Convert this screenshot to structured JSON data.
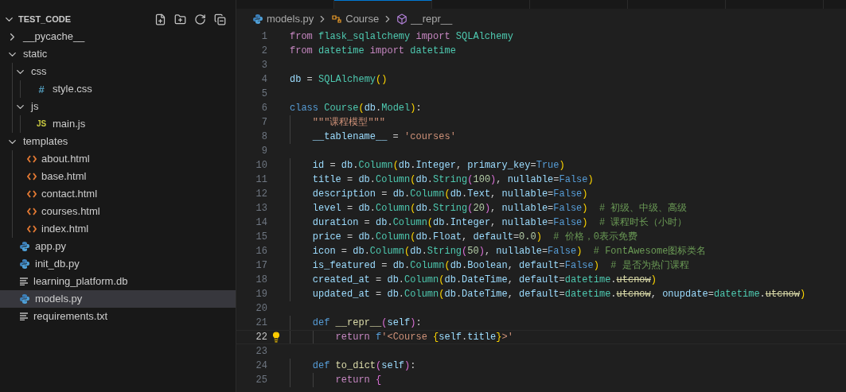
{
  "explorer": {
    "title": "TEST_CODE",
    "expanded": true,
    "items": [
      {
        "kind": "folder",
        "name": "__pycache__",
        "expanded": false,
        "selected": false
      },
      {
        "kind": "folder",
        "name": "static",
        "expanded": true,
        "selected": false,
        "children": [
          {
            "kind": "folder",
            "name": "css",
            "expanded": true,
            "selected": false,
            "children": [
              {
                "kind": "css",
                "glyph": "#",
                "name": "style.css",
                "selected": false
              }
            ]
          },
          {
            "kind": "folder",
            "name": "js",
            "expanded": true,
            "selected": false,
            "children": [
              {
                "kind": "js",
                "glyph": "JS",
                "name": "main.js",
                "selected": false
              }
            ]
          }
        ]
      },
      {
        "kind": "folder",
        "name": "templates",
        "expanded": true,
        "selected": false,
        "children": [
          {
            "kind": "html",
            "name": "about.html",
            "selected": false
          },
          {
            "kind": "html",
            "name": "base.html",
            "selected": false
          },
          {
            "kind": "html",
            "name": "contact.html",
            "selected": false
          },
          {
            "kind": "html",
            "name": "courses.html",
            "selected": false
          },
          {
            "kind": "html",
            "name": "index.html",
            "selected": false
          }
        ]
      },
      {
        "kind": "py",
        "name": "app.py",
        "selected": false
      },
      {
        "kind": "py",
        "name": "init_db.py",
        "selected": false
      },
      {
        "kind": "text",
        "name": "learning_platform.db",
        "selected": false
      },
      {
        "kind": "py",
        "name": "models.py",
        "selected": true
      },
      {
        "kind": "text",
        "name": "requirements.txt",
        "selected": false
      }
    ]
  },
  "tabs": [
    {
      "selected": false
    },
    {
      "selected": true
    },
    {
      "selected": false
    },
    {
      "selected": false
    },
    {
      "selected": false
    },
    {
      "selected": false
    }
  ],
  "breadcrumb": [
    {
      "kind": "py",
      "label": "models.py"
    },
    {
      "kind": "class",
      "label": "Course"
    },
    {
      "kind": "method",
      "label": "__repr__"
    }
  ],
  "code": [
    {
      "n": "1",
      "tokens": [
        {
          "text": "from",
          "kind": "kw"
        },
        {
          "text": " flask_sqlalchemy ",
          "kind": "cls"
        },
        {
          "text": "import",
          "kind": "kw"
        },
        {
          "text": " SQLAlchemy",
          "kind": "cls"
        }
      ]
    },
    {
      "n": "2",
      "tokens": [
        {
          "text": "from",
          "kind": "kw"
        },
        {
          "text": " datetime ",
          "kind": "cls"
        },
        {
          "text": "import",
          "kind": "kw"
        },
        {
          "text": " datetime",
          "kind": "cls"
        }
      ]
    },
    {
      "n": "3"
    },
    {
      "n": "4",
      "tokens": [
        {
          "text": "db",
          "kind": "var"
        },
        {
          "text": " = ",
          "kind": "p"
        },
        {
          "text": "SQLAlchemy",
          "kind": "cls"
        },
        {
          "text": "()",
          "kind": "br"
        }
      ]
    },
    {
      "n": "5"
    },
    {
      "n": "6",
      "tokens": [
        {
          "text": "class",
          "kind": "def"
        },
        {
          "text": " Course",
          "kind": "cls"
        },
        {
          "text": "(",
          "kind": "br"
        },
        {
          "text": "db",
          "kind": "var"
        },
        {
          "text": ".",
          "kind": "p"
        },
        {
          "text": "Model",
          "kind": "cls"
        },
        {
          "text": ")",
          "kind": "br"
        },
        {
          "text": ":",
          "kind": "p"
        }
      ]
    },
    {
      "n": "7",
      "tokens": [
        {
          "text": "    \"\"\"课程模型\"\"\"",
          "kind": "str"
        }
      ]
    },
    {
      "n": "8",
      "tokens": [
        {
          "text": "    __tablename__",
          "kind": "var"
        },
        {
          "text": " = ",
          "kind": "p"
        },
        {
          "text": "'courses'",
          "kind": "str"
        }
      ]
    },
    {
      "n": "9"
    },
    {
      "n": "10",
      "tokens": [
        {
          "text": "    id",
          "kind": "var"
        },
        {
          "text": " = ",
          "kind": "p"
        },
        {
          "text": "db",
          "kind": "var"
        },
        {
          "text": ".",
          "kind": "p"
        },
        {
          "text": "Column",
          "kind": "cls"
        },
        {
          "text": "(",
          "kind": "br"
        },
        {
          "text": "db",
          "kind": "var"
        },
        {
          "text": ".",
          "kind": "p"
        },
        {
          "text": "Integer",
          "kind": "var"
        },
        {
          "text": ", ",
          "kind": "p"
        },
        {
          "text": "primary_key",
          "kind": "var"
        },
        {
          "text": "=",
          "kind": "p"
        },
        {
          "text": "True",
          "kind": "def"
        },
        {
          "text": ")",
          "kind": "br"
        }
      ]
    },
    {
      "n": "11",
      "tokens": [
        {
          "text": "    title",
          "kind": "var"
        },
        {
          "text": " = ",
          "kind": "p"
        },
        {
          "text": "db",
          "kind": "var"
        },
        {
          "text": ".",
          "kind": "p"
        },
        {
          "text": "Column",
          "kind": "cls"
        },
        {
          "text": "(",
          "kind": "br"
        },
        {
          "text": "db",
          "kind": "var"
        },
        {
          "text": ".",
          "kind": "p"
        },
        {
          "text": "String",
          "kind": "cls"
        },
        {
          "text": "(",
          "kind": "br2"
        },
        {
          "text": "100",
          "kind": "num"
        },
        {
          "text": ")",
          "kind": "br2"
        },
        {
          "text": ", ",
          "kind": "p"
        },
        {
          "text": "nullable",
          "kind": "var"
        },
        {
          "text": "=",
          "kind": "p"
        },
        {
          "text": "False",
          "kind": "def"
        },
        {
          "text": ")",
          "kind": "br"
        }
      ]
    },
    {
      "n": "12",
      "tokens": [
        {
          "text": "    description",
          "kind": "var"
        },
        {
          "text": " = ",
          "kind": "p"
        },
        {
          "text": "db",
          "kind": "var"
        },
        {
          "text": ".",
          "kind": "p"
        },
        {
          "text": "Column",
          "kind": "cls"
        },
        {
          "text": "(",
          "kind": "br"
        },
        {
          "text": "db",
          "kind": "var"
        },
        {
          "text": ".",
          "kind": "p"
        },
        {
          "text": "Text",
          "kind": "var"
        },
        {
          "text": ", ",
          "kind": "p"
        },
        {
          "text": "nullable",
          "kind": "var"
        },
        {
          "text": "=",
          "kind": "p"
        },
        {
          "text": "False",
          "kind": "def"
        },
        {
          "text": ")",
          "kind": "br"
        }
      ]
    },
    {
      "n": "13",
      "tokens": [
        {
          "text": "    level",
          "kind": "var"
        },
        {
          "text": " = ",
          "kind": "p"
        },
        {
          "text": "db",
          "kind": "var"
        },
        {
          "text": ".",
          "kind": "p"
        },
        {
          "text": "Column",
          "kind": "cls"
        },
        {
          "text": "(",
          "kind": "br"
        },
        {
          "text": "db",
          "kind": "var"
        },
        {
          "text": ".",
          "kind": "p"
        },
        {
          "text": "String",
          "kind": "cls"
        },
        {
          "text": "(",
          "kind": "br2"
        },
        {
          "text": "20",
          "kind": "num"
        },
        {
          "text": ")",
          "kind": "br2"
        },
        {
          "text": ", ",
          "kind": "p"
        },
        {
          "text": "nullable",
          "kind": "var"
        },
        {
          "text": "=",
          "kind": "p"
        },
        {
          "text": "False",
          "kind": "def"
        },
        {
          "text": ")",
          "kind": "br"
        },
        {
          "text": "  # 初级、中级、高级",
          "kind": "cm"
        }
      ]
    },
    {
      "n": "14",
      "tokens": [
        {
          "text": "    duration",
          "kind": "var"
        },
        {
          "text": " = ",
          "kind": "p"
        },
        {
          "text": "db",
          "kind": "var"
        },
        {
          "text": ".",
          "kind": "p"
        },
        {
          "text": "Column",
          "kind": "cls"
        },
        {
          "text": "(",
          "kind": "br"
        },
        {
          "text": "db",
          "kind": "var"
        },
        {
          "text": ".",
          "kind": "p"
        },
        {
          "text": "Integer",
          "kind": "var"
        },
        {
          "text": ", ",
          "kind": "p"
        },
        {
          "text": "nullable",
          "kind": "var"
        },
        {
          "text": "=",
          "kind": "p"
        },
        {
          "text": "False",
          "kind": "def"
        },
        {
          "text": ")",
          "kind": "br"
        },
        {
          "text": "  # 课程时长（小时）",
          "kind": "cm"
        }
      ]
    },
    {
      "n": "15",
      "tokens": [
        {
          "text": "    price",
          "kind": "var"
        },
        {
          "text": " = ",
          "kind": "p"
        },
        {
          "text": "db",
          "kind": "var"
        },
        {
          "text": ".",
          "kind": "p"
        },
        {
          "text": "Column",
          "kind": "cls"
        },
        {
          "text": "(",
          "kind": "br"
        },
        {
          "text": "db",
          "kind": "var"
        },
        {
          "text": ".",
          "kind": "p"
        },
        {
          "text": "Float",
          "kind": "var"
        },
        {
          "text": ", ",
          "kind": "p"
        },
        {
          "text": "default",
          "kind": "var"
        },
        {
          "text": "=",
          "kind": "p"
        },
        {
          "text": "0.0",
          "kind": "num"
        },
        {
          "text": ")",
          "kind": "br"
        },
        {
          "text": "  # 价格，0表示免费",
          "kind": "cm"
        }
      ]
    },
    {
      "n": "16",
      "tokens": [
        {
          "text": "    icon",
          "kind": "var"
        },
        {
          "text": " = ",
          "kind": "p"
        },
        {
          "text": "db",
          "kind": "var"
        },
        {
          "text": ".",
          "kind": "p"
        },
        {
          "text": "Column",
          "kind": "cls"
        },
        {
          "text": "(",
          "kind": "br"
        },
        {
          "text": "db",
          "kind": "var"
        },
        {
          "text": ".",
          "kind": "p"
        },
        {
          "text": "String",
          "kind": "cls"
        },
        {
          "text": "(",
          "kind": "br2"
        },
        {
          "text": "50",
          "kind": "num"
        },
        {
          "text": ")",
          "kind": "br2"
        },
        {
          "text": ", ",
          "kind": "p"
        },
        {
          "text": "nullable",
          "kind": "var"
        },
        {
          "text": "=",
          "kind": "p"
        },
        {
          "text": "False",
          "kind": "def"
        },
        {
          "text": ")",
          "kind": "br"
        },
        {
          "text": "  # FontAwesome图标类名",
          "kind": "cm"
        }
      ]
    },
    {
      "n": "17",
      "tokens": [
        {
          "text": "    is_featured",
          "kind": "var"
        },
        {
          "text": " = ",
          "kind": "p"
        },
        {
          "text": "db",
          "kind": "var"
        },
        {
          "text": ".",
          "kind": "p"
        },
        {
          "text": "Column",
          "kind": "cls"
        },
        {
          "text": "(",
          "kind": "br"
        },
        {
          "text": "db",
          "kind": "var"
        },
        {
          "text": ".",
          "kind": "p"
        },
        {
          "text": "Boolean",
          "kind": "var"
        },
        {
          "text": ", ",
          "kind": "p"
        },
        {
          "text": "default",
          "kind": "var"
        },
        {
          "text": "=",
          "kind": "p"
        },
        {
          "text": "False",
          "kind": "def"
        },
        {
          "text": ")",
          "kind": "br"
        },
        {
          "text": "  # 是否为热门课程",
          "kind": "cm"
        }
      ]
    },
    {
      "n": "18",
      "tokens": [
        {
          "text": "    created_at",
          "kind": "var"
        },
        {
          "text": " = ",
          "kind": "p"
        },
        {
          "text": "db",
          "kind": "var"
        },
        {
          "text": ".",
          "kind": "p"
        },
        {
          "text": "Column",
          "kind": "cls"
        },
        {
          "text": "(",
          "kind": "br"
        },
        {
          "text": "db",
          "kind": "var"
        },
        {
          "text": ".",
          "kind": "p"
        },
        {
          "text": "DateTime",
          "kind": "var"
        },
        {
          "text": ", ",
          "kind": "p"
        },
        {
          "text": "default",
          "kind": "var"
        },
        {
          "text": "=",
          "kind": "p"
        },
        {
          "text": "datetime",
          "kind": "cls"
        },
        {
          "text": ".",
          "kind": "p"
        },
        {
          "text": "utcnow",
          "kind": "strike"
        },
        {
          "text": ")",
          "kind": "br"
        }
      ]
    },
    {
      "n": "19",
      "tokens": [
        {
          "text": "    updated_at",
          "kind": "var"
        },
        {
          "text": " = ",
          "kind": "p"
        },
        {
          "text": "db",
          "kind": "var"
        },
        {
          "text": ".",
          "kind": "p"
        },
        {
          "text": "Column",
          "kind": "cls"
        },
        {
          "text": "(",
          "kind": "br"
        },
        {
          "text": "db",
          "kind": "var"
        },
        {
          "text": ".",
          "kind": "p"
        },
        {
          "text": "DateTime",
          "kind": "var"
        },
        {
          "text": ", ",
          "kind": "p"
        },
        {
          "text": "default",
          "kind": "var"
        },
        {
          "text": "=",
          "kind": "p"
        },
        {
          "text": "datetime",
          "kind": "cls"
        },
        {
          "text": ".",
          "kind": "p"
        },
        {
          "text": "utcnow",
          "kind": "strike"
        },
        {
          "text": ", ",
          "kind": "p"
        },
        {
          "text": "onupdate",
          "kind": "var"
        },
        {
          "text": "=",
          "kind": "p"
        },
        {
          "text": "datetime",
          "kind": "cls"
        },
        {
          "text": ".",
          "kind": "p"
        },
        {
          "text": "utcnow",
          "kind": "strike"
        },
        {
          "text": ")",
          "kind": "br"
        }
      ]
    },
    {
      "n": "20"
    },
    {
      "n": "21",
      "tokens": [
        {
          "text": "    def",
          "kind": "def"
        },
        {
          "text": " __repr__",
          "kind": "fn"
        },
        {
          "text": "(",
          "kind": "br2"
        },
        {
          "text": "self",
          "kind": "var"
        },
        {
          "text": ")",
          "kind": "br2"
        },
        {
          "text": ":",
          "kind": "p"
        }
      ]
    },
    {
      "n": "22",
      "current": true,
      "lightbulb": true,
      "tokens": [
        {
          "text": "        return ",
          "kind": "kw"
        },
        {
          "text": "f",
          "kind": "def"
        },
        {
          "text": "'<Course ",
          "kind": "str"
        },
        {
          "text": "{",
          "kind": "br"
        },
        {
          "text": "self",
          "kind": "var"
        },
        {
          "text": ".",
          "kind": "p"
        },
        {
          "text": "title",
          "kind": "var"
        },
        {
          "text": "}",
          "kind": "br"
        },
        {
          "text": ">'",
          "kind": "str"
        }
      ]
    },
    {
      "n": "23"
    },
    {
      "n": "24",
      "tokens": [
        {
          "text": "    def",
          "kind": "def"
        },
        {
          "text": " to_dict",
          "kind": "fn"
        },
        {
          "text": "(",
          "kind": "br2"
        },
        {
          "text": "self",
          "kind": "var"
        },
        {
          "text": ")",
          "kind": "br2"
        },
        {
          "text": ":",
          "kind": "p"
        }
      ]
    },
    {
      "n": "25",
      "tokens": [
        {
          "text": "        return",
          "kind": "kw"
        },
        {
          "text": " {",
          "kind": "br2"
        }
      ]
    }
  ]
}
